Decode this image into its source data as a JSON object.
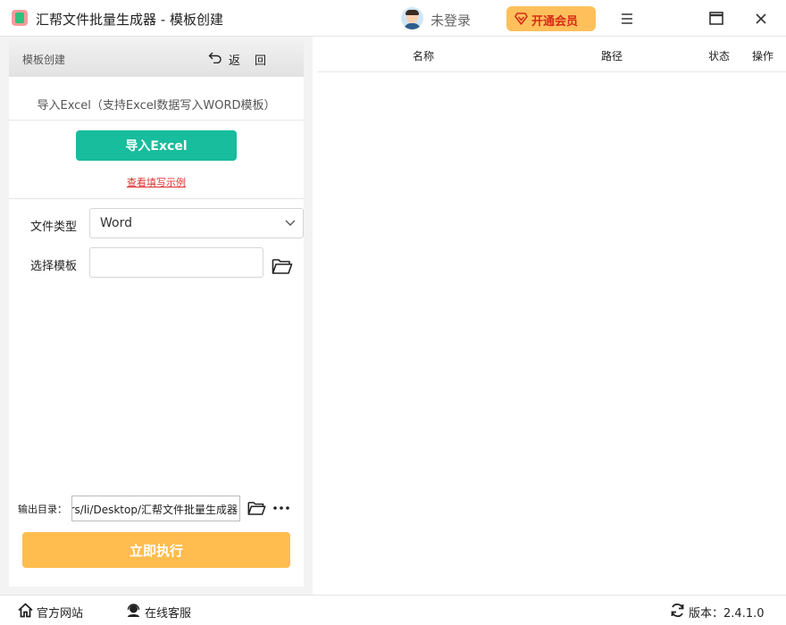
{
  "window": {
    "title": "汇帮文件批量生成器 - 模板创建",
    "login_text": "未登录",
    "vip_label": "开通会员"
  },
  "left_panel": {
    "header_title": "模板创建",
    "back_label": "返",
    "extra_label": "回",
    "import_description": "导入Excel（支持Excel数据写入WORD模板）",
    "import_button": "导入Excel",
    "example_link": "查看填写示例",
    "file_type_label": "文件类型",
    "file_type_value": "Word",
    "template_label": "选择模板",
    "template_value": "",
    "output_label": "输出目录：",
    "output_value": "rs/li/Desktop/汇帮文件批量生成器",
    "run_button": "立即执行"
  },
  "table": {
    "columns": [
      "名称",
      "路径",
      "状态",
      "操作"
    ]
  },
  "statusbar": {
    "website": "官方网站",
    "support": "在线客服",
    "version_label": "版本：",
    "version": "2.4.1.0"
  },
  "colors": {
    "accent_green": "#17bd9c",
    "accent_orange": "#ffbd4f",
    "vip_bg": "#ffc05c",
    "vip_text": "#d62b16",
    "link_red": "#e03131"
  }
}
